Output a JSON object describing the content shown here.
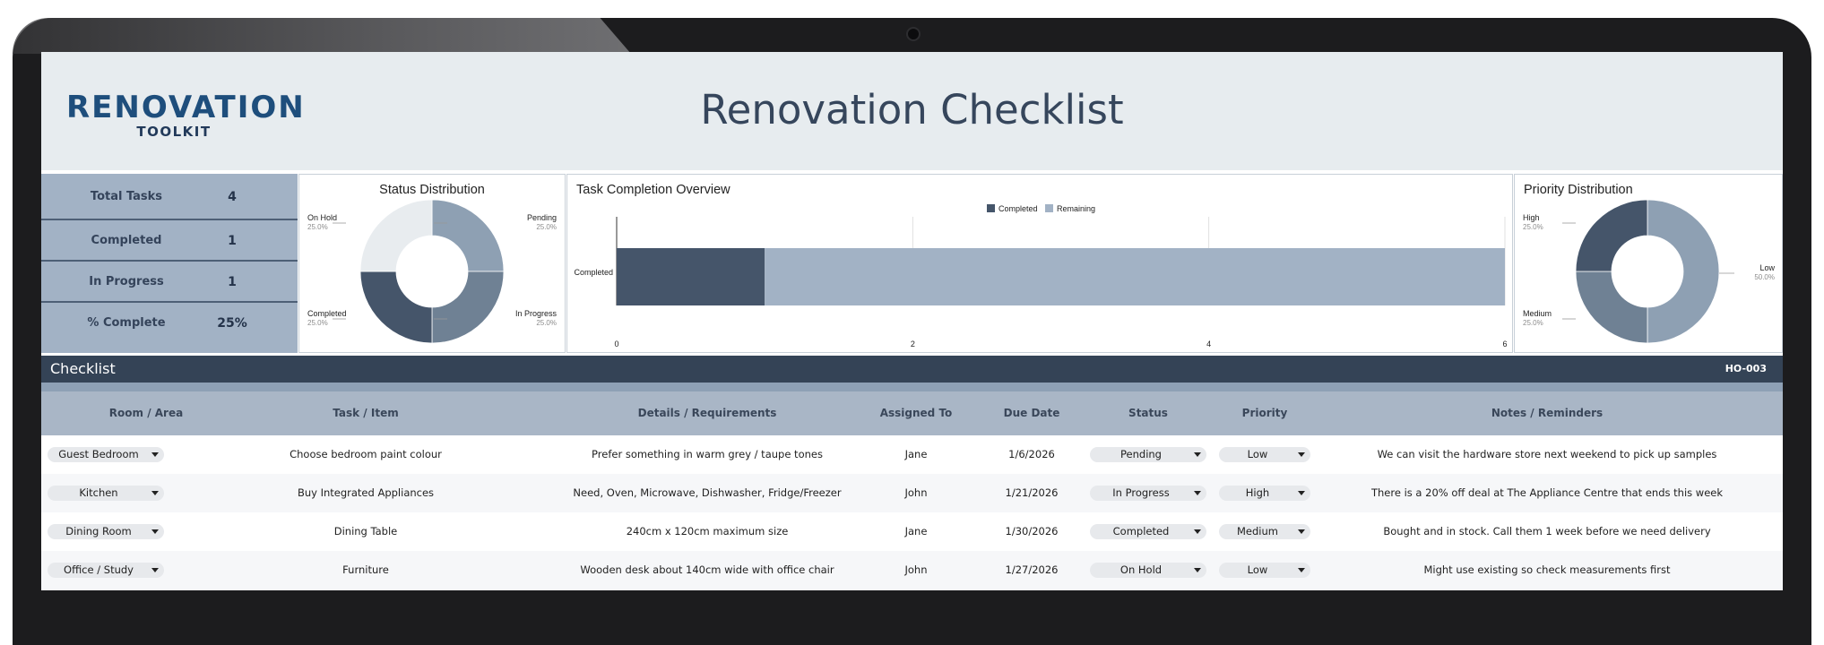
{
  "app": {
    "logo_top": "RENOVATION",
    "logo_bottom": "TOOLKIT",
    "title": "Renovation Checklist"
  },
  "stats": [
    {
      "label": "Total Tasks",
      "value": "4"
    },
    {
      "label": "Completed",
      "value": "1"
    },
    {
      "label": "In Progress",
      "value": "1"
    },
    {
      "label": "% Complete",
      "value": "25%"
    }
  ],
  "colors": {
    "dark": "#45556a",
    "mid": "#6f8194",
    "light": "#8ea0b3",
    "lightest": "#e8ecef",
    "remaining": "#a2b2c5"
  },
  "chart_data": [
    {
      "type": "pie",
      "title": "Status Distribution",
      "donut": true,
      "categories": [
        "Pending",
        "In Progress",
        "Completed",
        "On Hold"
      ],
      "values": [
        25.0,
        25.0,
        25.0,
        25.0
      ],
      "labels": [
        "25.0%",
        "25.0%",
        "25.0%",
        "25.0%"
      ],
      "colors": [
        "#8ea0b3",
        "#6f8194",
        "#45556a",
        "#e8ecef"
      ]
    },
    {
      "type": "bar",
      "orientation": "horizontal",
      "stacked": true,
      "title": "Task Completion Overview",
      "categories": [
        "Completed"
      ],
      "series": [
        {
          "name": "Completed",
          "values": [
            1
          ],
          "color": "#45556a"
        },
        {
          "name": "Remaining",
          "values": [
            5
          ],
          "color": "#a2b2c5"
        }
      ],
      "xlim": [
        0,
        6
      ],
      "xticks": [
        "0",
        "2",
        "4",
        "6"
      ],
      "legend": "top-center",
      "grid": true
    },
    {
      "type": "pie",
      "title": "Priority Distribution",
      "donut": true,
      "categories": [
        "Low",
        "Medium",
        "High"
      ],
      "values": [
        50.0,
        25.0,
        25.0
      ],
      "labels": [
        "50.0%",
        "25.0%",
        "25.0%"
      ],
      "colors": [
        "#8ea0b3",
        "#6f8194",
        "#45556a"
      ]
    }
  ],
  "checklist": {
    "title": "Checklist",
    "code": "HO-003",
    "columns": [
      "Room / Area",
      "Task / Item",
      "Details / Requirements",
      "Assigned To",
      "Due Date",
      "Status",
      "Priority",
      "Notes / Reminders"
    ],
    "rows": [
      {
        "room": "Guest Bedroom",
        "task": "Choose bedroom paint colour",
        "details": "Prefer something in warm grey / taupe tones",
        "assigned": "Jane",
        "due": "1/6/2026",
        "status": "Pending",
        "priority": "Low",
        "notes": "We can visit the hardware store next weekend to pick up samples"
      },
      {
        "room": "Kitchen",
        "task": "Buy Integrated Appliances",
        "details": "Need, Oven, Microwave, Dishwasher, Fridge/Freezer",
        "assigned": "John",
        "due": "1/21/2026",
        "status": "In Progress",
        "priority": "High",
        "notes": "There is a 20% off deal at The Appliance Centre that ends this week"
      },
      {
        "room": "Dining Room",
        "task": "Dining Table",
        "details": "240cm x 120cm maximum size",
        "assigned": "Jane",
        "due": "1/30/2026",
        "status": "Completed",
        "priority": "Medium",
        "notes": "Bought and in stock. Call them 1 week before we need delivery"
      },
      {
        "room": "Office / Study",
        "task": "Furniture",
        "details": "Wooden desk about 140cm wide with office chair",
        "assigned": "John",
        "due": "1/27/2026",
        "status": "On Hold",
        "priority": "Low",
        "notes": "Might use existing so check measurements first"
      }
    ]
  }
}
